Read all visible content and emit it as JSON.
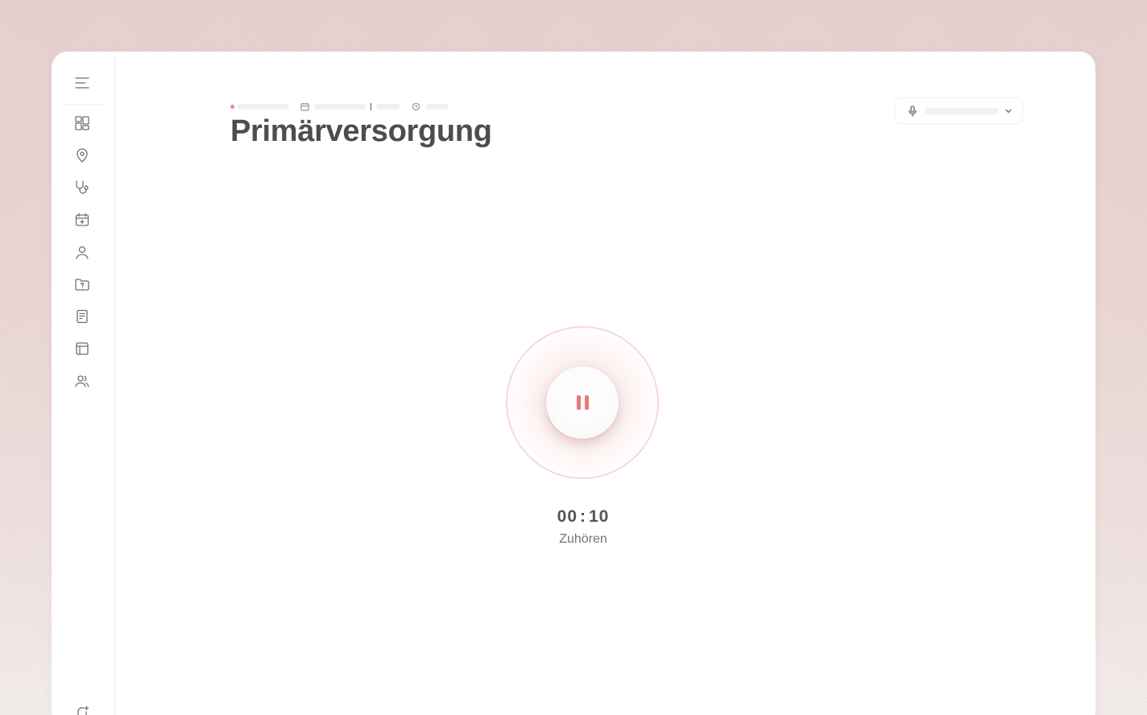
{
  "page": {
    "title": "Primärversorgung"
  },
  "sidebar": {
    "items": [
      {
        "icon": "dashboard-icon"
      },
      {
        "icon": "location-pin-icon"
      },
      {
        "icon": "stethoscope-icon"
      },
      {
        "icon": "calendar-add-icon"
      },
      {
        "icon": "user-icon"
      },
      {
        "icon": "folder-help-icon"
      },
      {
        "icon": "document-icon"
      },
      {
        "icon": "table-icon"
      },
      {
        "icon": "users-icon"
      }
    ]
  },
  "recorder": {
    "timer_minutes": "00",
    "timer_separator": ":",
    "timer_seconds": "10",
    "status": "Zuhören",
    "accent_color": "#ec7b78"
  }
}
